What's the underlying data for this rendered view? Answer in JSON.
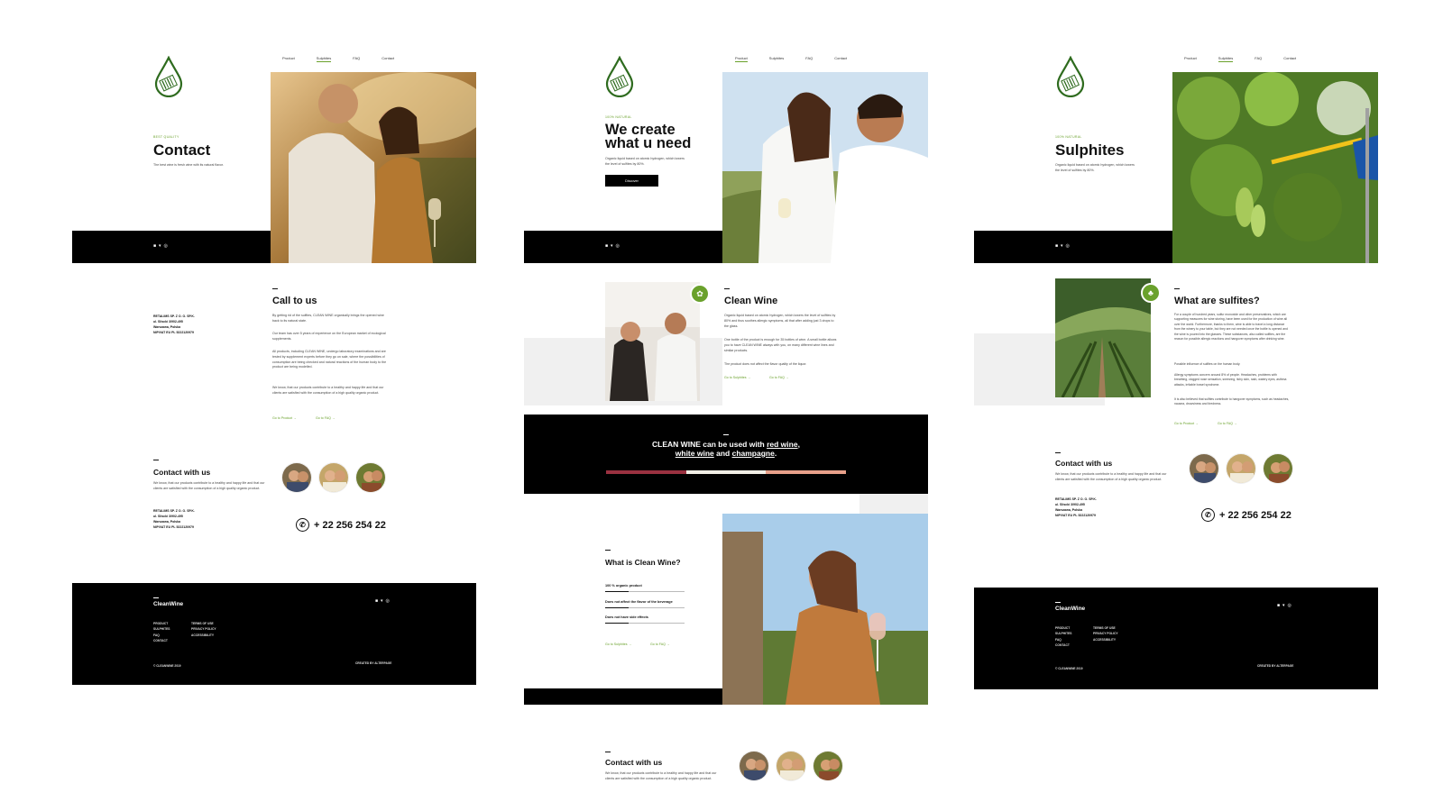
{
  "nav": {
    "items": [
      "Product",
      "Sulphites",
      "FAQ",
      "Contact"
    ]
  },
  "colors": {
    "accent": "#6aa12c",
    "dark": "#000000",
    "wine_red": "#9a3140",
    "wine_white": "#f2efe6",
    "champagne": "#e8a08a"
  },
  "contact_page": {
    "eyebrow": "BEST QUALITY",
    "title": "Contact",
    "subtitle": "The best wine is fresh wine with its natural flavor.",
    "call_title": "Call to us",
    "call_p1": "By getting rid of the sulfites, CLEAN WINE organically brings the opened wine back to its natural state.",
    "call_p2": "Our team has over 5 years of experience on the European market of ecological supplements.",
    "call_p3": "All products, including CLEAN WINE, undergo laboratory examinations and are tested by supplement experts before they go on sale, where the possibilities of consumption are being checked and natural reactions of the human body to the product are being modelled.",
    "call_p4": "We know, that our products contribute to a healthy and happy life and that our clients are satisfied with the consumption of a high quality organic product.",
    "link_product": "Go to Product →",
    "link_faq": "Go to FAQ →",
    "address": [
      "RETALIMS SP. Z O. O. SP.K.",
      "ul. Sliscki 3/902-495",
      "Warszawa, Polska",
      "NIP/VAT EU PL 5222120979"
    ],
    "contact_title": "Contact with us",
    "contact_text": "We know, that our products contribute to a healthy and happy life and that our clients are satisfied with the consumption of a high quality organic product.",
    "phone": "+ 22 256 254 22"
  },
  "product_page": {
    "eyebrow": "100% NATURAL",
    "title_line1": "We create",
    "title_line2": "what u need",
    "subtitle": "Organic liquid based on atomic hydrogen, which lowers the level of sulfites by 80%.",
    "button": "Discover",
    "clean_title": "Clean Wine",
    "clean_p1": "Organic liquid based on atomic hydrogen, which lowers the level of sulfites by 80% and thus soothes allergic symptoms, all that after adding just 3 drops to the glass.",
    "clean_p2": "One bottle of the product is enough for 35 bottles of wine. A small bottle allows you to have CLEAN WINE always with you, on many different wine lines and similar products.",
    "clean_p3": "The product does not affect the flavor quality of the liquor.",
    "link_sulphites": "Go to Sulphites →",
    "link_faq": "Go to FAQ →",
    "quote_pre": "CLEAN WINE can be used with ",
    "quote_red": "red wine",
    "quote_white": "white wine",
    "quote_and": " and ",
    "quote_champ": "champagne",
    "what_title": "What is Clean Wine?",
    "list": [
      "100 % organic product",
      "Does not affect the flavor of the beverage",
      "Does not have side effects"
    ],
    "contact_title": "Contact with us",
    "contact_text": "We know, that our products contribute to a healthy and happy life and that our clients are satisfied with the consumption of a high quality organic product."
  },
  "sulphites_page": {
    "eyebrow": "100% NATURAL",
    "title": "Sulphites",
    "subtitle": "Organic liquid based on atomic hydrogen, which lowers the level of sulfites by 80%.",
    "what_title": "What are sulfites?",
    "p1": "For a couple of hundred years, sulfur monoxide and other preservatives, which are supporting measures for wine storing, have been used for the production of wine all over the world. Furthermore, thanks to them, wine is able to travel a long distance from the winery to your table, but they are not needed once the bottle is opened and the wine is poured into the glasses. These substances, also called sulfites, are the reason for possible allergic reactions and hangover symptoms after drinking wine.",
    "p2": "Possible influence of sulfites on the human body.",
    "p3": "Allergy symptoms concern around 8% of people. Headaches, problems with breathing, clogged nose sensation, sneezing, itchy skin, rash, watery eyes, asthma attacks, irritable bowel syndrome.",
    "p4": "It is also believed that sulfites contribute to hangover symptoms, such as headaches, nausea, drowsiness and tiredness.",
    "link_product": "Go to Product →",
    "link_faq": "Go to FAQ →",
    "contact_title": "Contact with us",
    "contact_text": "We know, that our products contribute to a healthy and happy life and that our clients are satisfied with the consumption of a high quality organic product.",
    "address": [
      "RETALIMS SP. Z O. O. SP.K.",
      "ul. Sliscki 3/902-495",
      "Warszawa, Polska",
      "NIP/VAT EU PL 5222120979"
    ],
    "phone": "+ 22 256 254 22"
  },
  "footer": {
    "brand": "CleanWine",
    "col1": [
      "PRODUCT",
      "SULPHITES",
      "FAQ",
      "CONTACT"
    ],
    "col2": [
      "TERMS OF USE",
      "PRIVACY POLICY",
      "ACCESSIBILITY"
    ],
    "copyright": "© CLEANWINE 2019",
    "credit": "CREATED BY ALTERPAGE"
  },
  "social_icons": [
    "facebook-icon",
    "twitter-icon",
    "instagram-icon"
  ]
}
